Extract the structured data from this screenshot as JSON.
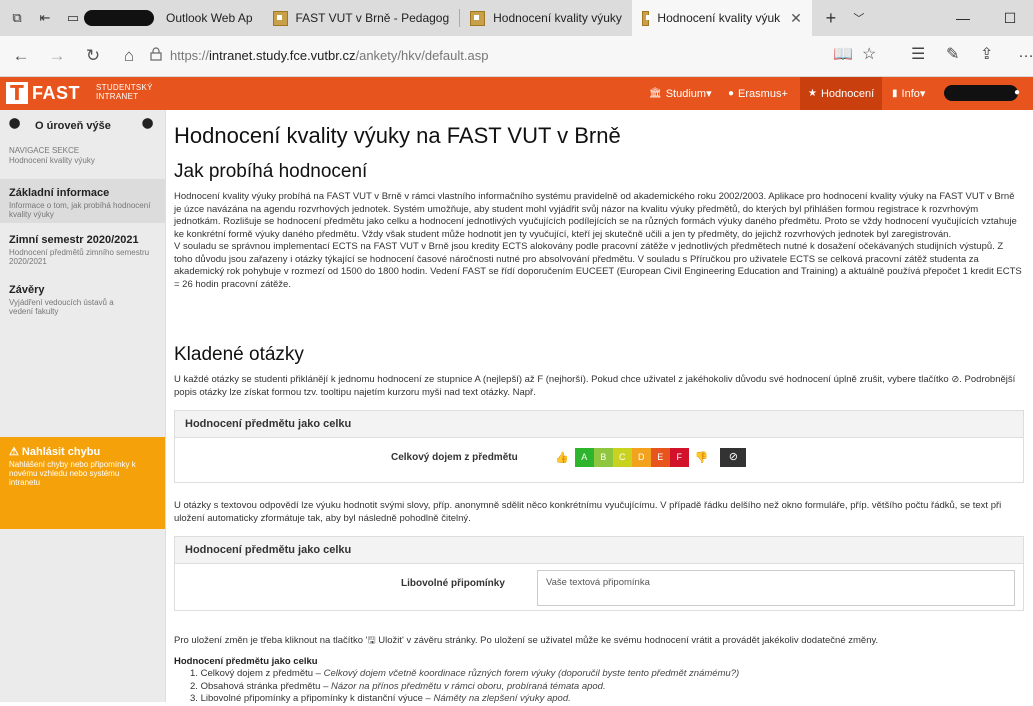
{
  "browser": {
    "tabs": [
      {
        "label": "Outlook Web Ap"
      },
      {
        "label": "FAST VUT v Brně - Pedagog"
      },
      {
        "label": "Hodnocení kvality výuky"
      },
      {
        "label": "Hodnocení kvality výuk"
      }
    ],
    "url_scheme": "https://",
    "url_host": "intranet.study.fce.vutbr.cz",
    "url_path": "/ankety/hkv/default.asp"
  },
  "site": {
    "logo_text": "FAST",
    "logo_sub1": "STUDENTSKÝ",
    "logo_sub2": "INTRANET",
    "menu": [
      {
        "label": "Studium"
      },
      {
        "label": "Erasmus+"
      },
      {
        "label": "Hodnocení"
      },
      {
        "label": "Info"
      }
    ]
  },
  "sidebar": {
    "up_label": "O úroveň výše",
    "nav_title": "NAVIGACE SEKCE",
    "nav_sub": "Hodnocení kvality výuky",
    "items": [
      {
        "title": "Základní informace",
        "sub": "Informace o tom, jak probíhá hodnocení kvality výuky"
      },
      {
        "title": "Zimní semestr 2020/2021",
        "sub": "Hodnocení předmětů zimního semestru 2020/2021"
      },
      {
        "title": "Závěry",
        "sub": "Vyjádření vedoucích ústavů a vedení fakulty"
      }
    ],
    "report": {
      "title": "Nahlásit chybu",
      "sub": "Nahlášení chyby nebo připomínky k novému vzhledu nebo systému intranetu"
    }
  },
  "main": {
    "title": "Hodnocení kvality výuky na FAST VUT v Brně",
    "h_how": "Jak probíhá hodnocení",
    "p1": "Hodnocení kvality výuky probíhá na FAST VUT v Brně v rámci vlastního informačního systému pravidelně od akademického roku 2002/2003. Aplikace pro hodnocení kvality výuky na FAST VUT v Brně je úzce navázána na agendu rozvrhových jednotek. Systém umožňuje, aby student mohl vyjádřit svůj názor na kvalitu výuky předmětů, do kterých byl přihlášen formou registrace k rozvrhovým jednotkám. Rozlišuje se hodnocení předmětu jako celku a hodnocení jednotlivých vyučujících podílejících se na různých formách výuky daného předmětu. Proto se vždy hodnocení vyučujících vztahuje ke konkrétní formě výuky daného předmětu. Vždy však student může hodnotit jen ty vyučující, kteří jej skutečně učili a jen ty předměty, do jejichž rozvrhových jednotek byl zaregistrován.",
    "p2": "V souladu se správnou implementací ECTS na FAST VUT v Brně jsou kredity ECTS alokovány podle pracovní zátěže v jednotlivých předmětech nutné k dosažení očekávaných studijních výstupů. Z toho důvodu jsou zařazeny i otázky týkající se hodnocení časové náročnosti nutné pro absolvování předmětu. V souladu s Příručkou pro uživatele ECTS se celková pracovní zátěž studenta za akademický rok pohybuje v rozmezí od 1500 do 1800 hodin. Vedení FAST se řídí doporučením EUCEET (European Civil Engineering Education and Training) a aktuálně používá přepočet 1 kredit ECTS = 26 hodin pracovní zátěže.",
    "h_questions": "Kladené otázky",
    "p3": "U každé otázky se studenti přiklánějí k jednomu hodnocení ze stupnice A (nejlepší) až F (nejhorší). Pokud chce uživatel z jakéhokoliv důvodu své hodnocení úplně zrušit, vybere tlačítko ⊘. Podrobnější popis otázky lze získat formou tzv. tooltipu najetím kurzoru myši nad text otázky. Např.",
    "panel1_head": "Hodnocení předmětu jako celku",
    "panel1_question": "Celkový dojem z předmětu",
    "grades": [
      "A",
      "B",
      "C",
      "D",
      "E",
      "F"
    ],
    "grade_colors": [
      "#2db52d",
      "#8ec63f",
      "#c9d21e",
      "#f2a21d",
      "#e8541d",
      "#d2112a"
    ],
    "p4": "U otázky s textovou odpovědí lze výuku hodnotit svými slovy, příp. anonymně sdělit něco konkrétnímu vyučujícímu. V případě řádku delšího než okno formuláře, příp. většího počtu řádků, se text při uložení automaticky zformátuje tak, aby byl následně pohodlně čitelný.",
    "panel2_head": "Hodnocení předmětu jako celku",
    "panel2_question": "Libovolné připomínky",
    "panel2_placeholder": "Vaše textová připomínka",
    "p5": "Pro uložení změn je třeba kliknout na tlačítko '🖫 Uložit' v závěru stránky. Po uložení se uživatel může ke svému hodnocení vrátit a provádět jakékoliv dodatečné změny.",
    "criteria_head": "Hodnocení předmětu jako celku",
    "criteria": [
      {
        "n": "1.",
        "name": "Celkový dojem z předmětu",
        "desc": "Celkový dojem včetně koordinace různých forem výuky (doporučil byste tento předmět známému?)"
      },
      {
        "n": "2.",
        "name": "Obsahová stránka předmětu",
        "desc": "Názor na přínos předmětu v rámci oboru, probíraná témata apod."
      },
      {
        "n": "3.",
        "name": "Libovolné připomínky a připomínky k distanční výuce",
        "desc": "Náměty na zlepšení výuky apod."
      }
    ]
  }
}
